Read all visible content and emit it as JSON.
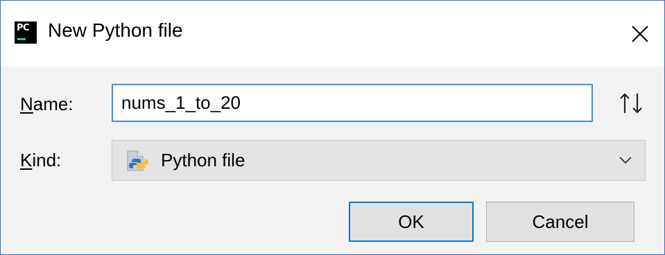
{
  "window": {
    "title": "New Python file",
    "logo_text": "PC"
  },
  "form": {
    "name_label_mnemonic": "N",
    "name_label_rest": "ame:",
    "name_value": "nums_1_to_20",
    "kind_label_mnemonic": "K",
    "kind_label_rest": "ind:",
    "kind_value": "Python file"
  },
  "buttons": {
    "ok_label": "OK",
    "cancel_label": "Cancel"
  },
  "icons": {
    "app": "pycharm-logo-icon",
    "close": "close-icon",
    "swap": "swap-up-down-icon",
    "kind": "python-file-icon",
    "dropdown": "chevron-down-icon"
  },
  "colors": {
    "focus_border": "#3d90df",
    "default_button_border": "#0078d7",
    "window_border": "#2b6fd1",
    "logo_accent": "#21d789"
  }
}
